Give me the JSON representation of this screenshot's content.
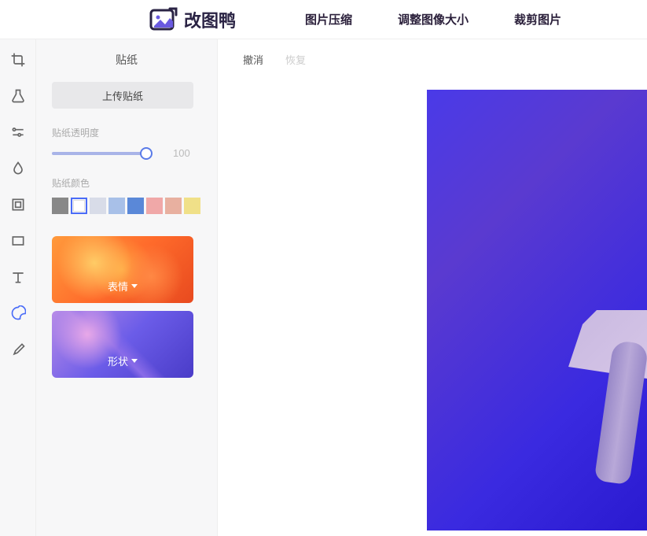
{
  "header": {
    "logo_text": "改图鸭",
    "nav": [
      "图片压缩",
      "调整图像大小",
      "裁剪图片"
    ]
  },
  "sidebar": {
    "title": "贴纸",
    "upload_label": "上传贴纸",
    "opacity_label": "贴纸透明度",
    "opacity_value": "100",
    "color_label": "贴纸颜色",
    "swatches": [
      "#888888",
      "#ffffff",
      "#d8dce8",
      "#a8c0e8",
      "#5a88d8",
      "#f0a8a8",
      "#e8b0a0",
      "#f0e088"
    ],
    "categories": [
      {
        "label": "表情"
      },
      {
        "label": "形状"
      }
    ]
  },
  "canvas": {
    "undo": "撤消",
    "redo": "恢复"
  }
}
